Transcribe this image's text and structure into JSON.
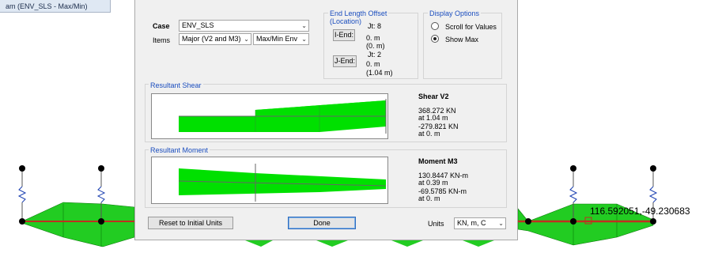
{
  "window_tab_title": "am (ENV_SLS - Max/Min)",
  "coordinate_readout": "116.592051,-49.230683",
  "dialog": {
    "case_label": "Case",
    "case_value": "ENV_SLS",
    "items_label": "Items",
    "items_value": "Major (V2 and M3)",
    "envelope_value": "Max/Min Env",
    "end_length_offset": {
      "title": "End Length Offset",
      "subtitle": "(Location)",
      "i_end_button": "I-End:",
      "i_jt": "Jt: 8",
      "i_value": "0. m",
      "i_location": "(0. m)",
      "j_end_button": "J-End:",
      "j_jt": "Jt: 2",
      "j_value": "0. m",
      "j_location": "(1.04 m)"
    },
    "display_options": {
      "title": "Display Options",
      "scroll_for_values": "Scroll for Values",
      "show_max": "Show Max",
      "selected": "show_max"
    },
    "shear": {
      "section_title": "Resultant Shear",
      "heading": "Shear V2",
      "max_value": "368.272 KN",
      "max_at": "at 1.04 m",
      "min_value": "-279.821 KN",
      "min_at": "at 0. m"
    },
    "moment": {
      "section_title": "Resultant Moment",
      "heading": "Moment M3",
      "max_value": "130.8447 KN-m",
      "max_at": "at 0.39 m",
      "min_value": "-69.5785 KN-m",
      "min_at": "at 0. m"
    },
    "reset_button": "Reset to Initial Units",
    "done_button": "Done",
    "units_label": "Units",
    "units_value": "KN, m, C"
  },
  "colors": {
    "diagram_fill": "#00e000",
    "frame_line": "#c03020",
    "accent_blue": "#1a4dbe"
  }
}
